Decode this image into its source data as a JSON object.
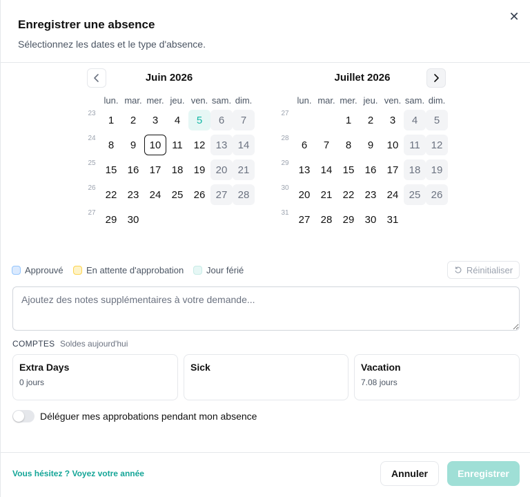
{
  "dialog": {
    "title": "Enregistrer une absence",
    "subtitle": "Sélectionnez les dates et le type d'absence.",
    "close_icon": "close-icon"
  },
  "calendar": {
    "weekdays": [
      "lun.",
      "mar.",
      "mer.",
      "jeu.",
      "ven.",
      "sam.",
      "dim."
    ],
    "months": [
      {
        "label": "Juin 2026",
        "weeks": [
          {
            "num": "23",
            "days": [
              "1",
              "2",
              "3",
              "4",
              "5",
              "6",
              "7"
            ]
          },
          {
            "num": "24",
            "days": [
              "8",
              "9",
              "10",
              "11",
              "12",
              "13",
              "14"
            ]
          },
          {
            "num": "25",
            "days": [
              "15",
              "16",
              "17",
              "18",
              "19",
              "20",
              "21"
            ]
          },
          {
            "num": "26",
            "days": [
              "22",
              "23",
              "24",
              "25",
              "26",
              "27",
              "28"
            ]
          },
          {
            "num": "27",
            "days": [
              "29",
              "30",
              "",
              "",
              "",
              "",
              ""
            ]
          }
        ],
        "holidays": [
          "5"
        ],
        "today": "10"
      },
      {
        "label": "Juillet 2026",
        "weeks": [
          {
            "num": "27",
            "days": [
              "",
              "",
              "1",
              "2",
              "3",
              "4",
              "5"
            ]
          },
          {
            "num": "28",
            "days": [
              "6",
              "7",
              "8",
              "9",
              "10",
              "11",
              "12"
            ]
          },
          {
            "num": "29",
            "days": [
              "13",
              "14",
              "15",
              "16",
              "17",
              "18",
              "19"
            ]
          },
          {
            "num": "30",
            "days": [
              "20",
              "21",
              "22",
              "23",
              "24",
              "25",
              "26"
            ]
          },
          {
            "num": "31",
            "days": [
              "27",
              "28",
              "29",
              "30",
              "31",
              "",
              ""
            ]
          }
        ],
        "holidays": [],
        "today": ""
      }
    ]
  },
  "legend": {
    "approved": "Approuvé",
    "pending": "En attente d'approbation",
    "holiday": "Jour férié",
    "colors": {
      "approved": "#dbeafe",
      "pending": "#fef3c7",
      "holiday": "#e6f7f5"
    }
  },
  "reset_label": "Réinitialiser",
  "notes_placeholder": "Ajoutez des notes supplémentaires à votre demande...",
  "balances": {
    "heading": "COMPTES",
    "subheading": "Soldes aujourd'hui",
    "cards": [
      {
        "title": "Extra Days",
        "value": "0 jours"
      },
      {
        "title": "Sick",
        "value": ""
      },
      {
        "title": "Vacation",
        "value": "7.08 jours"
      }
    ]
  },
  "delegate": {
    "label": "Déléguer mes approbations pendant mon absence",
    "enabled": false
  },
  "footer": {
    "link": "Vous hésitez ? Voyez votre année",
    "cancel": "Annuler",
    "save": "Enregistrer"
  },
  "colors": {
    "accent": "#14a597",
    "accent_disabled": "#9fdfd6"
  }
}
